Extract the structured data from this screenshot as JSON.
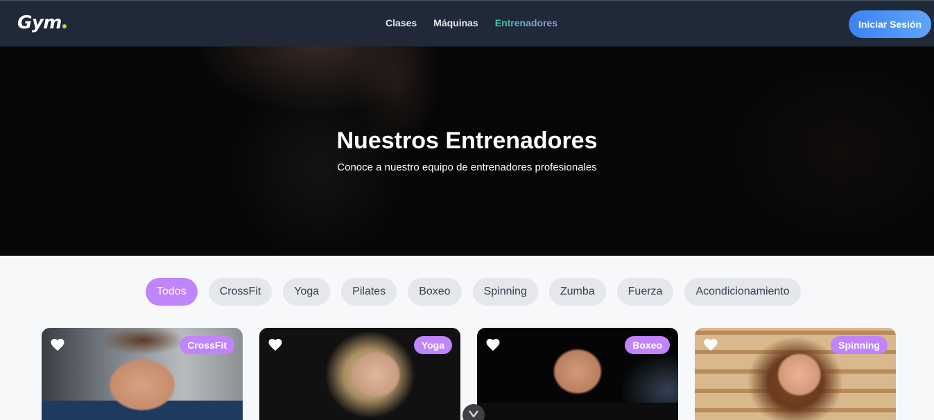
{
  "navbar": {
    "logo": "Gym",
    "links": [
      {
        "label": "Clases",
        "active": false
      },
      {
        "label": "Máquinas",
        "active": false
      },
      {
        "label": "Entrenadores",
        "active": true
      }
    ],
    "login_label": "Iniciar Sesión"
  },
  "hero": {
    "title": "Nuestros Entrenadores",
    "subtitle": "Conoce a nuestro equipo de entrenadores profesionales"
  },
  "filters": [
    {
      "label": "Todos",
      "active": true
    },
    {
      "label": "CrossFit",
      "active": false
    },
    {
      "label": "Yoga",
      "active": false
    },
    {
      "label": "Pilates",
      "active": false
    },
    {
      "label": "Boxeo",
      "active": false
    },
    {
      "label": "Spinning",
      "active": false
    },
    {
      "label": "Zumba",
      "active": false
    },
    {
      "label": "Fuerza",
      "active": false
    },
    {
      "label": "Acondicionamiento",
      "active": false
    }
  ],
  "trainers": [
    {
      "specialty": "CrossFit",
      "icon": "heart-icon"
    },
    {
      "specialty": "Yoga",
      "icon": "heart-icon"
    },
    {
      "specialty": "Boxeo",
      "icon": "heart-icon"
    },
    {
      "specialty": "Spinning",
      "icon": "heart-icon"
    }
  ],
  "colors": {
    "navbar_bg": "#1f2937",
    "accent_purple": "#c084fc",
    "login_blue": "#3b82f6",
    "logo_dot": "#a3e635"
  }
}
